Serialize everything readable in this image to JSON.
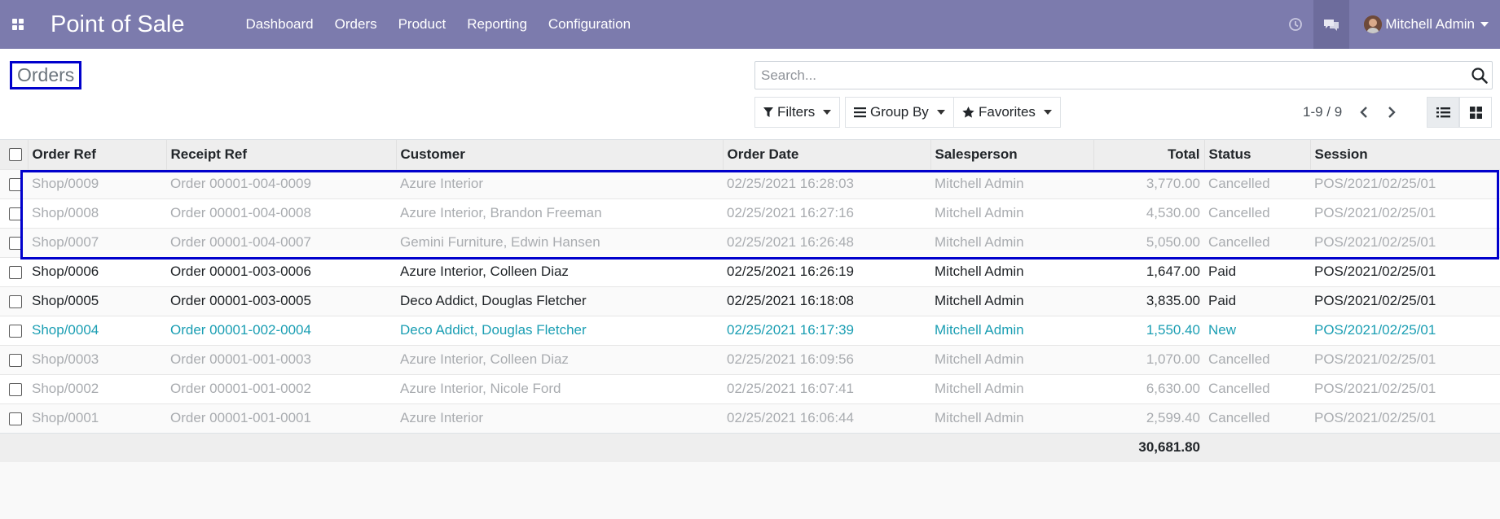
{
  "navbar": {
    "app_title": "Point of Sale",
    "menu": [
      "Dashboard",
      "Orders",
      "Product",
      "Reporting",
      "Configuration"
    ],
    "user_name": "Mitchell Admin",
    "background_color": "#7c7bad"
  },
  "control_panel": {
    "breadcrumb": "Orders",
    "search_placeholder": "Search...",
    "filters_label": "Filters",
    "group_by_label": "Group By",
    "favorites_label": "Favorites",
    "pager": "1-9 / 9"
  },
  "table": {
    "columns": [
      "Order Ref",
      "Receipt Ref",
      "Customer",
      "Order Date",
      "Salesperson",
      "Total",
      "Status",
      "Session"
    ],
    "rows": [
      {
        "order_ref": "Shop/0009",
        "receipt_ref": "Order 00001-004-0009",
        "customer": "Azure Interior",
        "order_date": "02/25/2021 16:28:03",
        "salesperson": "Mitchell Admin",
        "total": "3,770.00",
        "status": "Cancelled",
        "session": "POS/2021/02/25/01",
        "style": "muted"
      },
      {
        "order_ref": "Shop/0008",
        "receipt_ref": "Order 00001-004-0008",
        "customer": "Azure Interior, Brandon Freeman",
        "order_date": "02/25/2021 16:27:16",
        "salesperson": "Mitchell Admin",
        "total": "4,530.00",
        "status": "Cancelled",
        "session": "POS/2021/02/25/01",
        "style": "muted"
      },
      {
        "order_ref": "Shop/0007",
        "receipt_ref": "Order 00001-004-0007",
        "customer": "Gemini Furniture, Edwin Hansen",
        "order_date": "02/25/2021 16:26:48",
        "salesperson": "Mitchell Admin",
        "total": "5,050.00",
        "status": "Cancelled",
        "session": "POS/2021/02/25/01",
        "style": "muted"
      },
      {
        "order_ref": "Shop/0006",
        "receipt_ref": "Order 00001-003-0006",
        "customer": "Azure Interior, Colleen Diaz",
        "order_date": "02/25/2021 16:26:19",
        "salesperson": "Mitchell Admin",
        "total": "1,647.00",
        "status": "Paid",
        "session": "POS/2021/02/25/01",
        "style": "normal"
      },
      {
        "order_ref": "Shop/0005",
        "receipt_ref": "Order 00001-003-0005",
        "customer": "Deco Addict, Douglas Fletcher",
        "order_date": "02/25/2021 16:18:08",
        "salesperson": "Mitchell Admin",
        "total": "3,835.00",
        "status": "Paid",
        "session": "POS/2021/02/25/01",
        "style": "normal"
      },
      {
        "order_ref": "Shop/0004",
        "receipt_ref": "Order 00001-002-0004",
        "customer": "Deco Addict, Douglas Fletcher",
        "order_date": "02/25/2021 16:17:39",
        "salesperson": "Mitchell Admin",
        "total": "1,550.40",
        "status": "New",
        "session": "POS/2021/02/25/01",
        "style": "info"
      },
      {
        "order_ref": "Shop/0003",
        "receipt_ref": "Order 00001-001-0003",
        "customer": "Azure Interior, Colleen Diaz",
        "order_date": "02/25/2021 16:09:56",
        "salesperson": "Mitchell Admin",
        "total": "1,070.00",
        "status": "Cancelled",
        "session": "POS/2021/02/25/01",
        "style": "muted"
      },
      {
        "order_ref": "Shop/0002",
        "receipt_ref": "Order 00001-001-0002",
        "customer": "Azure Interior, Nicole Ford",
        "order_date": "02/25/2021 16:07:41",
        "salesperson": "Mitchell Admin",
        "total": "6,630.00",
        "status": "Cancelled",
        "session": "POS/2021/02/25/01",
        "style": "muted"
      },
      {
        "order_ref": "Shop/0001",
        "receipt_ref": "Order 00001-001-0001",
        "customer": "Azure Interior",
        "order_date": "02/25/2021 16:06:44",
        "salesperson": "Mitchell Admin",
        "total": "2,599.40",
        "status": "Cancelled",
        "session": "POS/2021/02/25/01",
        "style": "muted"
      }
    ],
    "footer_total": "30,681.80"
  }
}
